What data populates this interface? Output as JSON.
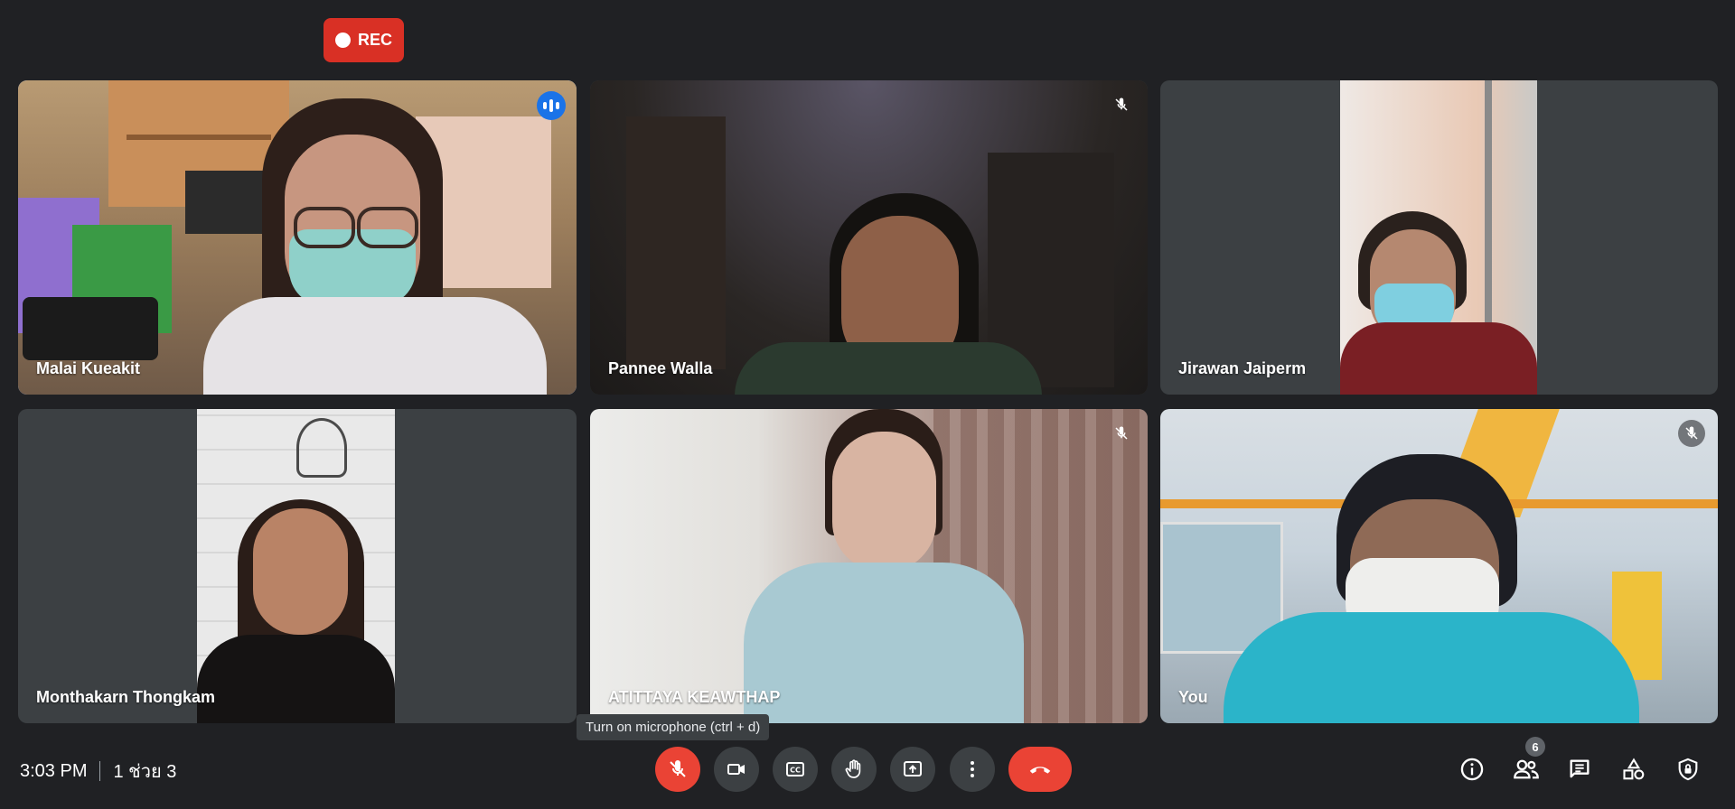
{
  "recording": {
    "label": "REC"
  },
  "tiles": [
    {
      "name": "Malai Kueakit",
      "speaking": true
    },
    {
      "name": "Pannee Walla",
      "muted": true
    },
    {
      "name": "Jirawan Jaiperm"
    },
    {
      "name": "Monthakarn Thongkam"
    },
    {
      "name": "ATITTAYA KEAWTHAP",
      "muted": true
    },
    {
      "name": "You",
      "muted": true
    }
  ],
  "footer": {
    "time": "3:03 PM",
    "meeting_name": "1 ช่วย 3",
    "tooltip": "Turn on microphone (ctrl + d)",
    "people_count": "6"
  },
  "controls": {
    "mic": "mic-off-icon",
    "camera": "videocam-icon",
    "captions": "closed-captions-icon",
    "hand": "raise-hand-icon",
    "present": "present-screen-icon",
    "more": "more-vert-icon",
    "end": "call-end-icon",
    "info": "info-icon",
    "people": "people-icon",
    "chat": "chat-icon",
    "activities": "activities-icon",
    "safety": "host-controls-icon"
  },
  "colors": {
    "background": "#202124",
    "tile": "#3c4043",
    "accent": "#8ab4f8",
    "danger": "#ea4335"
  }
}
